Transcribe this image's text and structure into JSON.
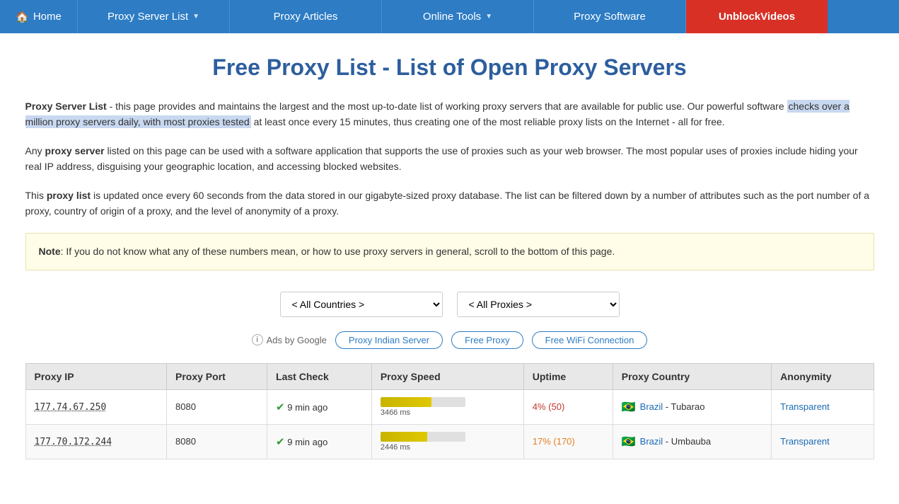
{
  "nav": {
    "home_label": "Home",
    "proxy_server_list_label": "Proxy Server List",
    "proxy_articles_label": "Proxy Articles",
    "online_tools_label": "Online Tools",
    "proxy_software_label": "Proxy Software",
    "unblock_videos_label": "UnblockVideos"
  },
  "page": {
    "title": "Free Proxy List - List of Open Proxy Servers",
    "intro_p1_prefix": "",
    "intro_bold1": "Proxy Server List",
    "intro_p1_text": " - this page provides and maintains the largest and the most up-to-date list of working proxy servers that are available for public use. Our powerful software checks over a million proxy servers daily, with most proxies tested at least once every 15 minutes, thus creating one of the most reliable proxy lists on the Internet - all for free.",
    "intro_p2_prefix": "Any ",
    "intro_bold2": "proxy server",
    "intro_p2_text": " listed on this page can be used with a software application that supports the use of proxies such as your web browser. The most popular uses of proxies include hiding your real IP address, disguising your geographic location, and accessing blocked websites.",
    "intro_p3_prefix": "This ",
    "intro_bold3": "proxy list",
    "intro_p3_text": " is updated once every 60 seconds from the data stored in our gigabyte-sized proxy database. The list can be filtered down by a number of attributes such as the port number of a proxy, country of origin of a proxy, and the level of anonymity of a proxy.",
    "note_label": "Note",
    "note_text": ": If you do not know what any of these numbers mean, or how to use proxy servers in general, scroll to the bottom of this page."
  },
  "filters": {
    "countries_placeholder": "< All Countries >",
    "proxies_placeholder": "< All Proxies >"
  },
  "ads": {
    "info_icon": "i",
    "ads_by_google": "Ads by Google",
    "pill1": "Proxy Indian Server",
    "pill2": "Free Proxy",
    "pill3": "Free WiFi Connection"
  },
  "table": {
    "headers": [
      "Proxy IP",
      "Proxy Port",
      "Last Check",
      "Proxy Speed",
      "Uptime",
      "Proxy Country",
      "Anonymity"
    ],
    "rows": [
      {
        "ip": "177.74.67.250",
        "port": "8080",
        "last_check": "9 min ago",
        "speed_ms": "3466 ms",
        "speed_pct": 60,
        "speed_class": "medium",
        "uptime_pct": "4%",
        "uptime_count": "(50)",
        "uptime_class": "low",
        "flag": "🇧🇷",
        "country": "Brazil",
        "city": "Tubarao",
        "anonymity": "Transparent"
      },
      {
        "ip": "177.70.172.244",
        "port": "8080",
        "last_check": "9 min ago",
        "speed_ms": "2446 ms",
        "speed_pct": 55,
        "speed_class": "medium",
        "uptime_pct": "17%",
        "uptime_count": "(170)",
        "uptime_class": "medium",
        "flag": "🇧🇷",
        "country": "Brazil",
        "city": "Umbauba",
        "anonymity": "Transparent"
      }
    ]
  }
}
